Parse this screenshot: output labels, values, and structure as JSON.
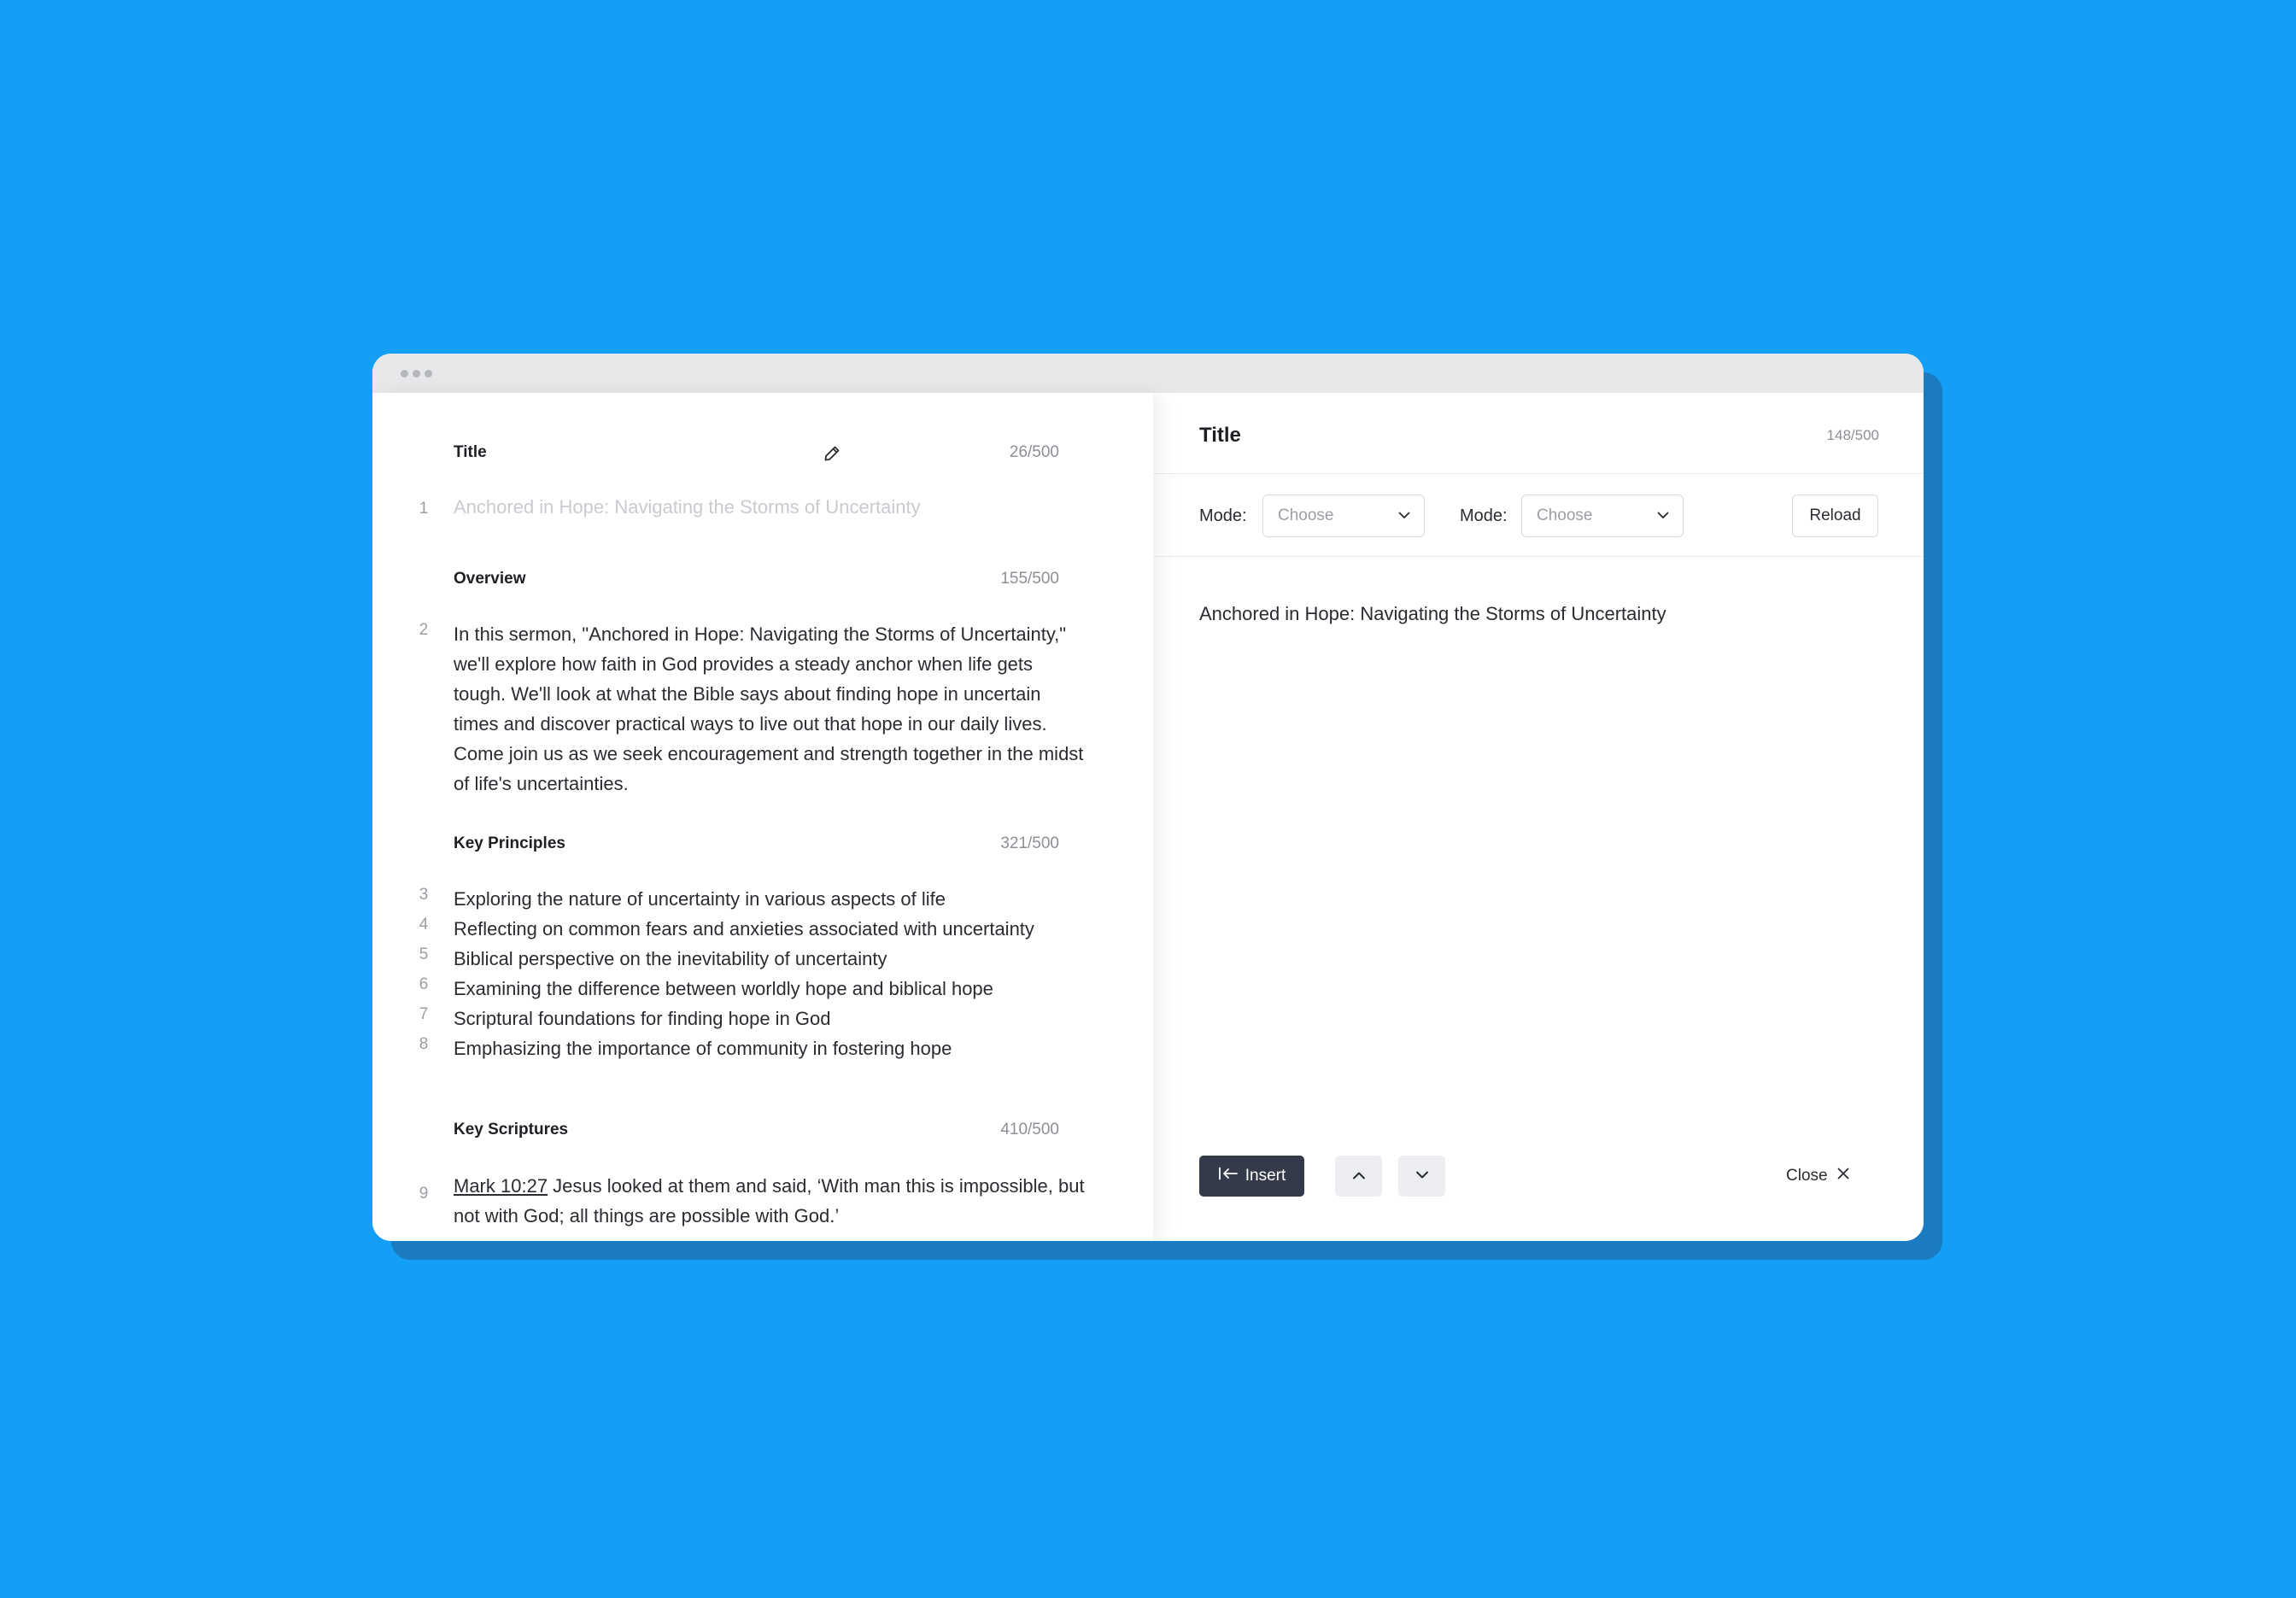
{
  "colors": {
    "background": "#149ff7",
    "shadow": "#1a7bc0",
    "insert_button": "#343a4a"
  },
  "editor": {
    "sections": {
      "title": {
        "label": "Title",
        "count": "26/500",
        "lines": [
          {
            "number": "1",
            "text": "Anchored in Hope: Navigating the Storms of Uncertainty"
          }
        ]
      },
      "overview": {
        "label": "Overview",
        "count": "155/500",
        "line_number": "2",
        "lines": [
          "In this sermon, \"Anchored in Hope: Navigating the Storms of Uncertainty,\"",
          "we'll explore how faith in God provides a steady anchor when life gets",
          "tough. We'll look at what the Bible says about finding hope in uncertain",
          "times and discover practical ways to live out that hope in our daily lives.",
          "Come join us as we seek encouragement and strength together in the midst",
          "of life's uncertainties."
        ]
      },
      "key_principles": {
        "label": "Key Principles",
        "count": "321/500",
        "items": [
          {
            "number": "3",
            "text": "Exploring the nature of uncertainty in various aspects of life"
          },
          {
            "number": "4",
            "text": "Reflecting on common fears and anxieties associated with uncertainty"
          },
          {
            "number": "5",
            "text": "Biblical perspective on the inevitability of uncertainty"
          },
          {
            "number": "6",
            "text": "Examining the difference between worldly hope and biblical hope"
          },
          {
            "number": "7",
            "text": "Scriptural foundations for finding hope in God"
          },
          {
            "number": "8",
            "text": "Emphasizing the importance of community in fostering hope"
          }
        ]
      },
      "key_scriptures": {
        "label": "Key Scriptures",
        "count": "410/500",
        "line_number": "9",
        "reference": "Mark 10:27",
        "line1": " Jesus looked at them and said, ‘With man this is impossible, but",
        "line2": "not with God; all things are possible with God.’"
      }
    }
  },
  "panel": {
    "title": "Title",
    "count": "148/500",
    "mode1_label": "Mode:",
    "mode1_value": "Choose",
    "mode2_label": "Mode:",
    "mode2_value": "Choose",
    "reload_label": "Reload",
    "content": "Anchored in Hope: Navigating the Storms of Uncertainty",
    "insert_label": "Insert",
    "close_label": "Close"
  }
}
